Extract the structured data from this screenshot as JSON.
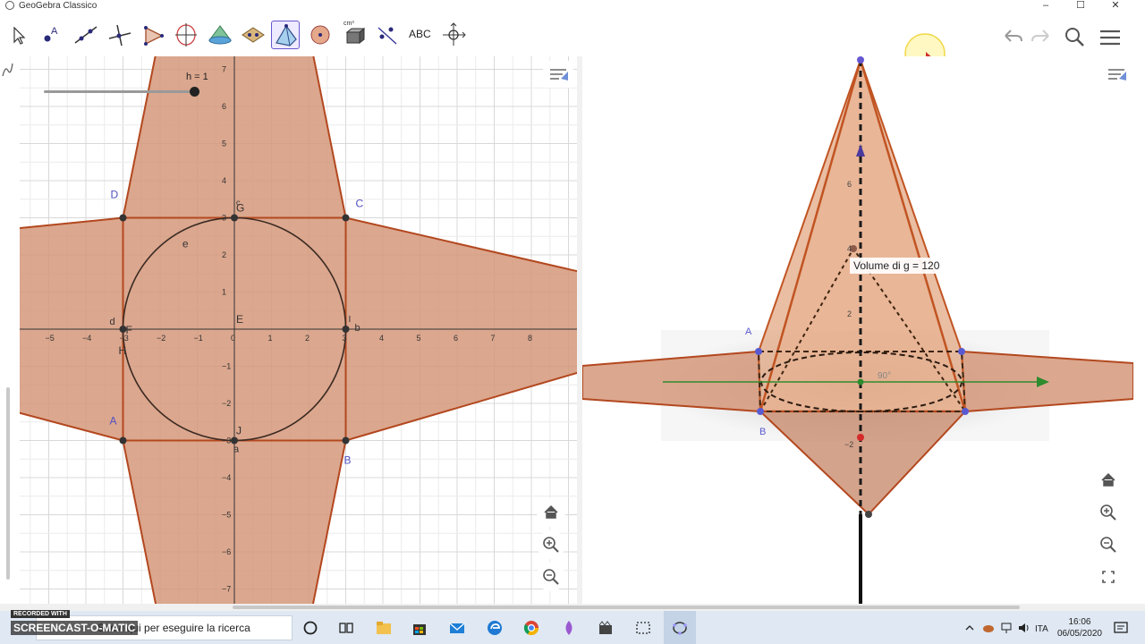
{
  "window": {
    "title": "GeoGebra Classico",
    "minimize": "–",
    "maximize": "☐",
    "close": "✕"
  },
  "toolbar": {
    "tools": [
      {
        "name": "move",
        "icon": "arrow-pointer-icon"
      },
      {
        "name": "point",
        "icon": "point-icon"
      },
      {
        "name": "line",
        "icon": "line-icon"
      },
      {
        "name": "perpendicular",
        "icon": "perpendicular-line-icon"
      },
      {
        "name": "polygon",
        "icon": "polygon-icon"
      },
      {
        "name": "circle",
        "icon": "circle-axis-icon"
      },
      {
        "name": "solid",
        "icon": "cone-icon"
      },
      {
        "name": "plane",
        "icon": "plane-icon"
      },
      {
        "name": "pyramid",
        "icon": "pyramid-icon"
      },
      {
        "name": "sphere",
        "icon": "sphere-icon"
      },
      {
        "name": "measure",
        "icon": "volume-icon",
        "label": "cm³"
      },
      {
        "name": "reflect",
        "icon": "reflect-icon"
      },
      {
        "name": "text",
        "icon": "text-icon",
        "label": "ABC"
      },
      {
        "name": "rotate-view",
        "icon": "rotate-view-icon"
      }
    ],
    "selected": 8
  },
  "graphics2d": {
    "slider_label": "h = 1",
    "x_ticks": [
      "−5",
      "−4",
      "−3",
      "−2",
      "−1",
      "0",
      "1",
      "2",
      "3",
      "4",
      "5",
      "6",
      "7",
      "8"
    ],
    "y_ticks": [
      "7",
      "6",
      "5",
      "4",
      "3",
      "2",
      "1",
      "−1",
      "−2",
      "−3",
      "−4",
      "−5",
      "−6",
      "−7"
    ],
    "point_labels": {
      "A": "A",
      "B": "B",
      "C": "C",
      "D": "D",
      "E": "E",
      "F": "F",
      "G": "G",
      "H": "H",
      "I": "I",
      "J": "J",
      "a": "a",
      "b": "b",
      "c": "c",
      "d": "d",
      "e": "e"
    }
  },
  "graphics3d": {
    "volume_label": "Volume di g = 120",
    "angle_label": "90°",
    "point_labels": {
      "A": "A",
      "B": "B"
    },
    "z_ticks": [
      "6",
      "4",
      "2",
      "−2"
    ]
  },
  "taskbar": {
    "recorded": "RECORDED WITH",
    "screencast": "SCREENCAST-O-MATIC",
    "search_placeholder": "Scrivi qui per eseguire la ricerca",
    "time": "16:06",
    "date": "06/05/2020"
  },
  "colors": {
    "net_fill": "#d5987a",
    "net_stroke": "#b3481f",
    "accent": "#6557d2"
  }
}
